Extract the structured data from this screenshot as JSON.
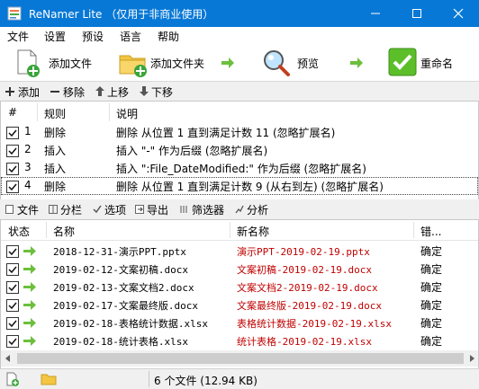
{
  "window": {
    "title": "ReNamer Lite （仅用于非商业使用）",
    "minimize_icon": "minimize-icon",
    "maximize_icon": "maximize-icon",
    "close_icon": "close-icon"
  },
  "menu": [
    "文件",
    "设置",
    "预设",
    "语言",
    "帮助"
  ],
  "toolbar": {
    "add_files": "添加文件",
    "add_folder": "添加文件夹",
    "preview": "预览",
    "rename": "重命名"
  },
  "rule_toolbar": {
    "add": "添加",
    "remove": "移除",
    "move_up": "上移",
    "move_down": "下移"
  },
  "rules": {
    "headers": {
      "num": "#",
      "rule": "规则",
      "desc": "说明"
    },
    "rows": [
      {
        "num": "1",
        "rule": "删除",
        "desc": "删除 从位置 1 直到满足计数 11 (忽略扩展名)",
        "checked": true
      },
      {
        "num": "2",
        "rule": "插入",
        "desc": "插入 \"-\" 作为后缀 (忽略扩展名)",
        "checked": true
      },
      {
        "num": "3",
        "rule": "插入",
        "desc": "插入 \":File_DateModified:\" 作为后缀 (忽略扩展名)",
        "checked": true
      },
      {
        "num": "4",
        "rule": "删除",
        "desc": "删除 从位置 1 直到满足计数 9 (从右到左) (忽略扩展名)",
        "checked": true
      }
    ]
  },
  "file_toolbar": {
    "files": "文件",
    "columns": "分栏",
    "options": "选项",
    "export": "导出",
    "filters": "筛选器",
    "analyze": "分析"
  },
  "files": {
    "headers": {
      "state": "状态",
      "name": "名称",
      "new_name": "新名称",
      "error": "错..."
    },
    "rows": [
      {
        "name": "2018-12-31-演示PPT.pptx",
        "new_name": "演示PPT-2019-02-19.pptx",
        "status": "确定",
        "checked": true
      },
      {
        "name": "2019-02-12-文案初稿.docx",
        "new_name": "文案初稿-2019-02-19.docx",
        "status": "确定",
        "checked": true
      },
      {
        "name": "2019-02-13-文案文档2.docx",
        "new_name": "文案文档2-2019-02-19.docx",
        "status": "确定",
        "checked": true
      },
      {
        "name": "2019-02-17-文案最终版.docx",
        "new_name": "文案最终版-2019-02-19.docx",
        "status": "确定",
        "checked": true
      },
      {
        "name": "2019-02-18-表格统计数据.xlsx",
        "new_name": "表格统计数据-2019-02-19.xlsx",
        "status": "确定",
        "checked": true
      },
      {
        "name": "2019-02-18-统计表格.xlsx",
        "new_name": "统计表格-2019-02-19.xlsx",
        "status": "确定",
        "checked": true
      }
    ]
  },
  "status": {
    "text": "6 个文件 (12.94 KB)"
  },
  "colors": {
    "titlebar": "#0778d6",
    "new_name": "#c00000",
    "ok_arrow": "#4caf50"
  }
}
